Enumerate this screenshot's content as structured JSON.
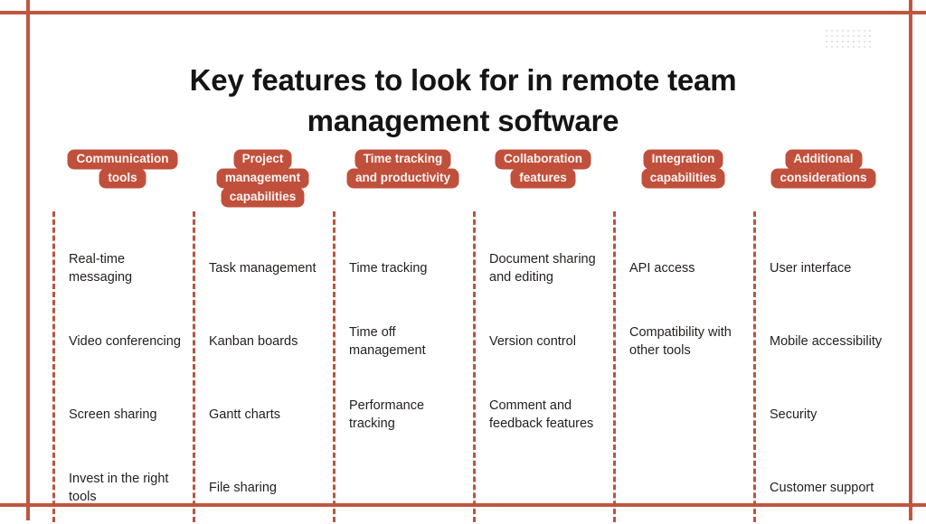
{
  "title": "Key features to look for in remote team management software",
  "theme": {
    "accent": "#c0503c",
    "divider": "#b9553f",
    "frame": "#c0563f",
    "text": "#231f1e",
    "title_text": "#141414",
    "background": "#ffffff",
    "dot_color": "#d8d8d8"
  },
  "decoration": {
    "dot_grid_columns": 9,
    "dot_grid_rows": 4
  },
  "columns": [
    {
      "header_lines": [
        "Communication",
        "tools"
      ],
      "items": [
        "Real-time messaging",
        "Video conferencing",
        "Screen sharing",
        "Invest in the right tools"
      ]
    },
    {
      "header_lines": [
        "Project",
        "management",
        "capabilities"
      ],
      "items": [
        "Task management",
        "Kanban boards",
        "Gantt charts",
        "File sharing"
      ]
    },
    {
      "header_lines": [
        "Time tracking",
        "and productivity"
      ],
      "items": [
        "Time tracking",
        "Time off management",
        "Performance tracking",
        ""
      ]
    },
    {
      "header_lines": [
        "Collaboration",
        "features"
      ],
      "items": [
        "Document sharing and editing",
        "Version control",
        "Comment and feedback features",
        ""
      ]
    },
    {
      "header_lines": [
        "Integration",
        "capabilities"
      ],
      "items": [
        "API access",
        "Compatibility with other tools",
        "",
        ""
      ]
    },
    {
      "header_lines": [
        "Additional",
        "considerations"
      ],
      "items": [
        "User interface",
        "Mobile accessibility",
        "Security",
        "Customer support"
      ]
    }
  ]
}
